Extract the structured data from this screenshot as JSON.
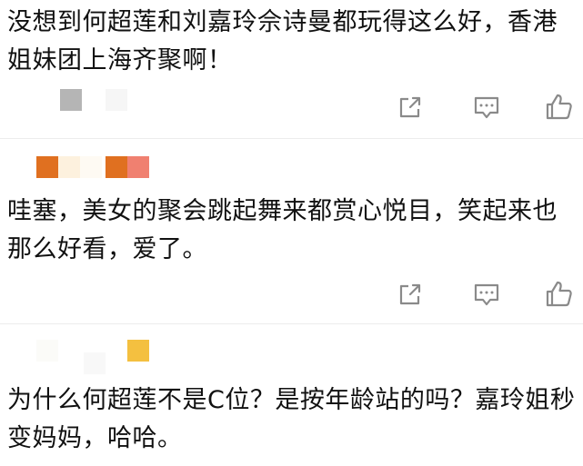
{
  "comments": [
    {
      "text": "没想到何超莲和刘嘉玲佘诗曼都玩得这么好，香港姐妹团上海齐聚啊！",
      "actions": [
        "share-icon",
        "comment-icon",
        "like-icon"
      ]
    },
    {
      "text": "哇塞，美女的聚会跳起舞来都赏心悦目，笑起来也那么好看，爱了。",
      "actions": [
        "share-icon",
        "comment-icon",
        "like-icon"
      ]
    },
    {
      "text": "为什么何超莲不是C位？是按年龄站的吗？嘉玲姐秒变妈妈，哈哈。"
    }
  ],
  "avatar_mosaic_colors": {
    "gray": "#b5b5b5",
    "light_gray": "#f4f4f4",
    "orange": "#e07020",
    "cream": "#fdf1de",
    "salmon": "#f08070",
    "yellow": "#f4c040"
  },
  "icon_color": "#8a8a8a"
}
